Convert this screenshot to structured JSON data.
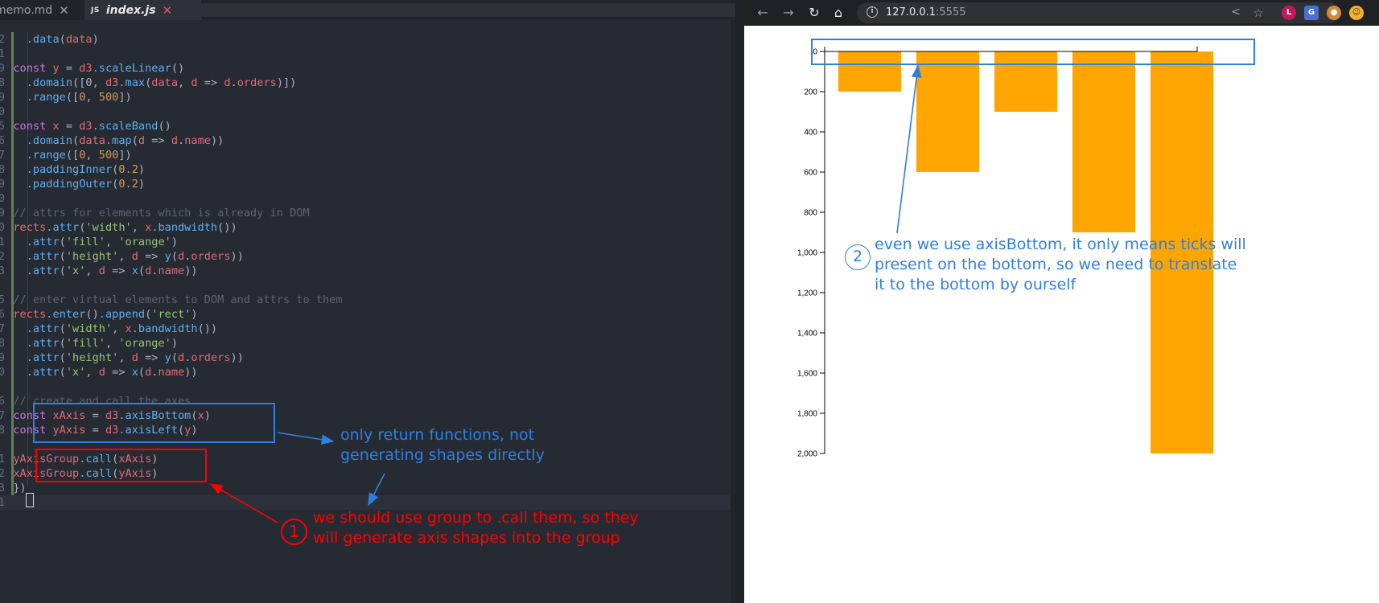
{
  "editor": {
    "tabs": [
      {
        "label": "memo.md",
        "close": "✕"
      },
      {
        "label": "index.js",
        "badge": "JS",
        "close": "✕"
      }
    ],
    "line_numbers": [
      "2",
      "1",
      "",
      "9",
      "8",
      "9",
      "0",
      "",
      "5",
      "6",
      "7",
      "8",
      "9",
      "0",
      "",
      "9",
      "0",
      "1",
      "2",
      "3",
      "",
      "5",
      "6",
      "7",
      "8",
      "9",
      "0",
      "",
      "6",
      "7",
      "8",
      "",
      "1",
      "2",
      "3",
      "1"
    ],
    "code": [
      {
        "n": "2",
        "t": [
          [
            "pl",
            "    "
          ],
          [
            "fn",
            ".data"
          ],
          [
            "pl",
            "("
          ],
          [
            "vr",
            "data"
          ],
          [
            "pl",
            ")"
          ]
        ]
      },
      {
        "n": "1",
        "t": []
      },
      {
        "n": "9",
        "t": [
          [
            "kw",
            "  const "
          ],
          [
            "vr",
            "y"
          ],
          [
            "pl",
            " = "
          ],
          [
            "vr",
            "d3"
          ],
          [
            "fn",
            ".scaleLinear"
          ],
          [
            "pl",
            "()"
          ]
        ]
      },
      {
        "n": "8",
        "t": [
          [
            "fn",
            "    .domain"
          ],
          [
            "pl",
            "([0, "
          ],
          [
            "vr",
            "d3"
          ],
          [
            "fn",
            ".max"
          ],
          [
            "pl",
            "("
          ],
          [
            "vr",
            "data"
          ],
          [
            "pl",
            ", "
          ],
          [
            "vr",
            "d"
          ],
          [
            "pl",
            " => "
          ],
          [
            "vr",
            "d"
          ],
          [
            "pl",
            "."
          ],
          [
            "vr",
            "orders"
          ],
          [
            "pl",
            ")])"
          ]
        ]
      },
      {
        "n": "9",
        "t": [
          [
            "fn",
            "    .range"
          ],
          [
            "pl",
            "(["
          ],
          [
            "nm",
            "0"
          ],
          [
            "pl",
            ", "
          ],
          [
            "nm",
            "500"
          ],
          [
            "pl",
            "])"
          ]
        ]
      },
      {
        "n": "0",
        "t": []
      },
      {
        "n": "5",
        "t": [
          [
            "kw",
            "  const "
          ],
          [
            "vr",
            "x"
          ],
          [
            "pl",
            " = "
          ],
          [
            "vr",
            "d3"
          ],
          [
            "fn",
            ".scaleBand"
          ],
          [
            "pl",
            "()"
          ]
        ]
      },
      {
        "n": "6",
        "t": [
          [
            "fn",
            "    .domain"
          ],
          [
            "pl",
            "("
          ],
          [
            "vr",
            "data"
          ],
          [
            "fn",
            ".map"
          ],
          [
            "pl",
            "("
          ],
          [
            "vr",
            "d"
          ],
          [
            "pl",
            " => "
          ],
          [
            "vr",
            "d"
          ],
          [
            "pl",
            "."
          ],
          [
            "vr",
            "name"
          ],
          [
            "pl",
            "))"
          ]
        ]
      },
      {
        "n": "7",
        "t": [
          [
            "fn",
            "    .range"
          ],
          [
            "pl",
            "(["
          ],
          [
            "nm",
            "0"
          ],
          [
            "pl",
            ", "
          ],
          [
            "nm",
            "500"
          ],
          [
            "pl",
            "])"
          ]
        ]
      },
      {
        "n": "8",
        "t": [
          [
            "fn",
            "    .paddingInner"
          ],
          [
            "pl",
            "("
          ],
          [
            "nm",
            "0.2"
          ],
          [
            "pl",
            ")"
          ]
        ]
      },
      {
        "n": "9",
        "t": [
          [
            "fn",
            "    .paddingOuter"
          ],
          [
            "pl",
            "("
          ],
          [
            "nm",
            "0.2"
          ],
          [
            "pl",
            ")"
          ]
        ]
      },
      {
        "n": "0",
        "t": []
      },
      {
        "n": "9",
        "t": [
          [
            "cm",
            "  // attrs for elements which is already in DOM"
          ]
        ]
      },
      {
        "n": "0",
        "t": [
          [
            "vr",
            "  rects"
          ],
          [
            "fn",
            ".attr"
          ],
          [
            "pl",
            "("
          ],
          [
            "st",
            "'width'"
          ],
          [
            "pl",
            ", "
          ],
          [
            "vr",
            "x"
          ],
          [
            "fn",
            ".bandwidth"
          ],
          [
            "pl",
            "())"
          ]
        ]
      },
      {
        "n": "1",
        "t": [
          [
            "fn",
            "    .attr"
          ],
          [
            "pl",
            "("
          ],
          [
            "st",
            "'fill'"
          ],
          [
            "pl",
            ", "
          ],
          [
            "st",
            "'orange'"
          ],
          [
            "pl",
            ")"
          ]
        ]
      },
      {
        "n": "2",
        "t": [
          [
            "fn",
            "    .attr"
          ],
          [
            "pl",
            "("
          ],
          [
            "st",
            "'height'"
          ],
          [
            "pl",
            ", "
          ],
          [
            "vr",
            "d"
          ],
          [
            "pl",
            " => "
          ],
          [
            "fn",
            "y"
          ],
          [
            "pl",
            "("
          ],
          [
            "vr",
            "d"
          ],
          [
            "pl",
            "."
          ],
          [
            "vr",
            "orders"
          ],
          [
            "pl",
            "))"
          ]
        ]
      },
      {
        "n": "3",
        "t": [
          [
            "fn",
            "    .attr"
          ],
          [
            "pl",
            "("
          ],
          [
            "st",
            "'x'"
          ],
          [
            "pl",
            ", "
          ],
          [
            "vr",
            "d"
          ],
          [
            "pl",
            " => "
          ],
          [
            "fn",
            "x"
          ],
          [
            "pl",
            "("
          ],
          [
            "vr",
            "d"
          ],
          [
            "pl",
            "."
          ],
          [
            "vr",
            "name"
          ],
          [
            "pl",
            "))"
          ]
        ]
      },
      {
        "n": "",
        "t": []
      },
      {
        "n": "5",
        "t": [
          [
            "cm",
            "  // enter virtual elements to DOM and attrs to them"
          ]
        ]
      },
      {
        "n": "6",
        "t": [
          [
            "vr",
            "  rects"
          ],
          [
            "fn",
            ".enter"
          ],
          [
            "pl",
            "()"
          ],
          [
            "fn",
            ".append"
          ],
          [
            "pl",
            "("
          ],
          [
            "st",
            "'rect'"
          ],
          [
            "pl",
            ")"
          ]
        ]
      },
      {
        "n": "7",
        "t": [
          [
            "fn",
            "    .attr"
          ],
          [
            "pl",
            "("
          ],
          [
            "st",
            "'width'"
          ],
          [
            "pl",
            ", "
          ],
          [
            "vr",
            "x"
          ],
          [
            "fn",
            ".bandwidth"
          ],
          [
            "pl",
            "())"
          ]
        ]
      },
      {
        "n": "8",
        "t": [
          [
            "fn",
            "    .attr"
          ],
          [
            "pl",
            "("
          ],
          [
            "st",
            "'fill'"
          ],
          [
            "pl",
            ", "
          ],
          [
            "st",
            "'orange'"
          ],
          [
            "pl",
            ")"
          ]
        ]
      },
      {
        "n": "9",
        "t": [
          [
            "fn",
            "    .attr"
          ],
          [
            "pl",
            "("
          ],
          [
            "st",
            "'height'"
          ],
          [
            "pl",
            ", "
          ],
          [
            "vr",
            "d"
          ],
          [
            "pl",
            " => "
          ],
          [
            "fn",
            "y"
          ],
          [
            "pl",
            "("
          ],
          [
            "vr",
            "d"
          ],
          [
            "pl",
            "."
          ],
          [
            "vr",
            "orders"
          ],
          [
            "pl",
            "))"
          ]
        ]
      },
      {
        "n": "0",
        "t": [
          [
            "fn",
            "    .attr"
          ],
          [
            "pl",
            "("
          ],
          [
            "st",
            "'x'"
          ],
          [
            "pl",
            ", "
          ],
          [
            "vr",
            "d"
          ],
          [
            "pl",
            " => "
          ],
          [
            "fn",
            "x"
          ],
          [
            "pl",
            "("
          ],
          [
            "vr",
            "d"
          ],
          [
            "pl",
            "."
          ],
          [
            "vr",
            "name"
          ],
          [
            "pl",
            "))"
          ]
        ]
      },
      {
        "n": "",
        "t": []
      },
      {
        "n": "6",
        "t": [
          [
            "cm",
            "  // create and call the axes"
          ]
        ]
      },
      {
        "n": "7",
        "t": [
          [
            "kw",
            "  const "
          ],
          [
            "vr",
            "xAxis"
          ],
          [
            "pl",
            " = "
          ],
          [
            "vr",
            "d3"
          ],
          [
            "fn",
            ".axisBottom"
          ],
          [
            "pl",
            "("
          ],
          [
            "vr",
            "x"
          ],
          [
            "pl",
            ")"
          ]
        ]
      },
      {
        "n": "8",
        "t": [
          [
            "kw",
            "  const "
          ],
          [
            "vr",
            "yAxis"
          ],
          [
            "pl",
            " = "
          ],
          [
            "vr",
            "d3"
          ],
          [
            "fn",
            ".axisLeft"
          ],
          [
            "pl",
            "("
          ],
          [
            "vr",
            "y"
          ],
          [
            "pl",
            ")"
          ]
        ]
      },
      {
        "n": "",
        "t": []
      },
      {
        "n": "1",
        "t": [
          [
            "vr",
            "  yAxisGroup"
          ],
          [
            "fn",
            ".call"
          ],
          [
            "pl",
            "("
          ],
          [
            "vr",
            "xAxis"
          ],
          [
            "pl",
            ")"
          ]
        ]
      },
      {
        "n": "2",
        "t": [
          [
            "vr",
            "  xAxisGroup"
          ],
          [
            "fn",
            ".call"
          ],
          [
            "pl",
            "("
          ],
          [
            "vr",
            "yAxis"
          ],
          [
            "pl",
            ")"
          ]
        ]
      },
      {
        "n": "3",
        "t": [
          [
            "pl",
            "  })"
          ]
        ]
      },
      {
        "n": "1",
        "t": []
      }
    ],
    "annotations": {
      "blue_note": "only return functions, not\ngenerating shapes directly",
      "red_note": "we should use group to .call them, so they\nwill generate axis shapes into the group",
      "red_number": "1",
      "red_color": "#ff0000",
      "blue_color": "#2f7fe0"
    }
  },
  "browser": {
    "url_host": "127.0.0.1",
    "url_port": ":5555",
    "icons": [
      "back-icon",
      "forward-icon",
      "reload-icon",
      "home-icon",
      "info-icon",
      "share-icon",
      "star-icon"
    ],
    "annotation": {
      "number": "2",
      "text": "even we use axisBottom, it only means ticks will\npresent on the bottom, so we need to translate\nit to the bottom by ourself",
      "color": "#2f7fe0"
    }
  },
  "chart_data": {
    "type": "bar",
    "bar_color": "#ffa500",
    "values": [
      200,
      600,
      300,
      900,
      2000
    ],
    "y_ticks": [
      "0",
      "200",
      "400",
      "600",
      "800",
      "1,000",
      "1,200",
      "1,400",
      "1,600",
      "1,800",
      "2,000"
    ],
    "ylim": [
      0,
      2000
    ],
    "y_axis_inverted": true,
    "title": "",
    "xlabel": "",
    "ylabel": ""
  }
}
